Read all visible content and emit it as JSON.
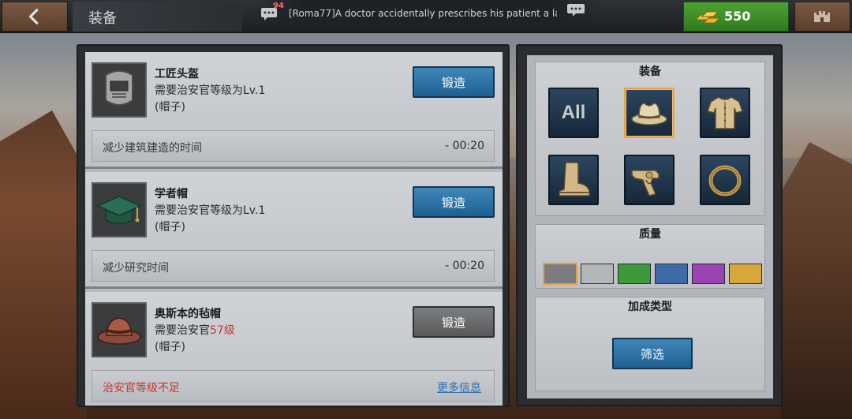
{
  "header": {
    "title": "装备",
    "back_icon": "back-arrow-icon",
    "chat": {
      "unread_count": "94",
      "message": "[Roma77]A doctor accidentally prescribes his patient a la.."
    },
    "gold": {
      "amount": "550",
      "icon": "gold-bars-icon"
    },
    "castle_icon": "castle-icon"
  },
  "equipment_list": [
    {
      "name": "工匠头盔",
      "requirement": "需要治安官等级为Lv.1",
      "type": "(帽子)",
      "forge_label": "锻造",
      "forge_enabled": true,
      "icon": "welding-helmet-icon",
      "effect": "减少建筑建造的时间",
      "effect_time": "- 00:20"
    },
    {
      "name": "学者帽",
      "requirement": "需要治安官等级为Lv.1",
      "type": "(帽子)",
      "forge_label": "锻造",
      "forge_enabled": true,
      "icon": "graduation-cap-icon",
      "effect": "减少研究时间",
      "effect_time": "- 00:20"
    },
    {
      "name": "奥斯本的毡帽",
      "requirement_prefix": "需要治安官",
      "requirement_level": "57级",
      "type": "(帽子)",
      "forge_label": "锻造",
      "forge_enabled": false,
      "icon": "fedora-hat-icon",
      "effect": "治安官等级不足",
      "more_info": "更多信息"
    }
  ],
  "filter_panel": {
    "equipment_section": {
      "title": "装备",
      "slots": [
        {
          "label": "All",
          "icon": "all-icon",
          "selected": false
        },
        {
          "icon": "cowboy-hat-icon",
          "selected": true
        },
        {
          "icon": "shirt-icon",
          "selected": false
        },
        {
          "icon": "boot-icon",
          "selected": false
        },
        {
          "icon": "revolver-icon",
          "selected": false
        },
        {
          "icon": "ring-icon",
          "selected": false
        }
      ]
    },
    "quality_section": {
      "title": "质量",
      "colors": [
        "#7b7d80",
        "#b4b7ba",
        "#3c9a3c",
        "#3f6aa8",
        "#9a43b2",
        "#d8a73b"
      ],
      "selected_index": 0
    },
    "bonus_section": {
      "title": "加成类型",
      "filter_label": "筛选"
    }
  }
}
